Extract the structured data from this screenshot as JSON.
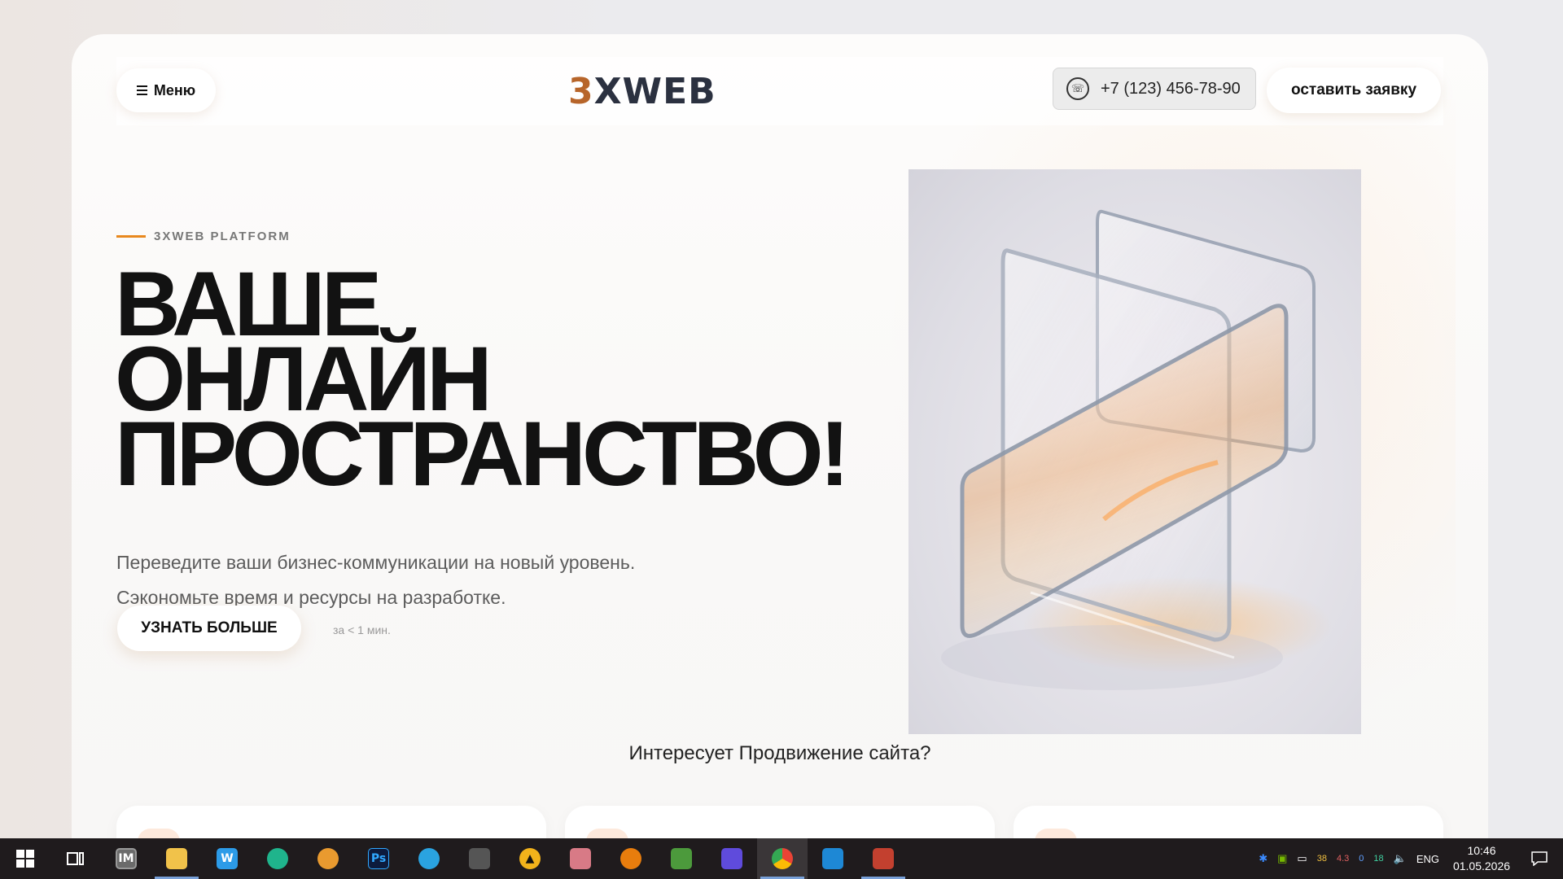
{
  "header": {
    "menu_label": "Меню",
    "logo_prefix": "3",
    "logo_rest": "XWEB",
    "phone": "+7 (123) 456-78-90",
    "cta_label": "оставить заявку"
  },
  "hero": {
    "eyebrow": "3XWEB PLATFORM",
    "title_lines": [
      "ВАШЕ",
      "ОНЛАЙН",
      "ПРОСТРАНСТВО!"
    ],
    "subtitle_lines": [
      "Переведите ваши бизнес-коммуникации на новый уровень.",
      "Сэкономьте время и ресурсы на разработке."
    ],
    "button_label": "УЗНАТЬ БОЛЬШЕ",
    "time_note": "за < 1 мин."
  },
  "section": {
    "question": "Интересует Продвижение сайта?"
  },
  "taskbar": {
    "apps": [
      {
        "name": "start-icon",
        "glyph": "",
        "color": "#ffffff"
      },
      {
        "name": "task-view-icon",
        "glyph": "",
        "color": "#ffffff"
      },
      {
        "name": "app-im-icon",
        "glyph": "IM",
        "color": "#6b6b6b"
      },
      {
        "name": "file-explorer-icon",
        "glyph": "",
        "color": "#f1c24a"
      },
      {
        "name": "app-w-icon",
        "glyph": "W",
        "color": "#2c9be8"
      },
      {
        "name": "app-turtle-icon",
        "glyph": "",
        "color": "#1fb48c"
      },
      {
        "name": "app-eye-icon",
        "glyph": "",
        "color": "#e99a2f"
      },
      {
        "name": "photoshop-icon",
        "glyph": "Ps",
        "color": "#0d1b3d"
      },
      {
        "name": "telegram-icon",
        "glyph": "",
        "color": "#2aa3e0"
      },
      {
        "name": "app-gamepad-icon",
        "glyph": "",
        "color": "#2b2b2b"
      },
      {
        "name": "app-triangle-icon",
        "glyph": "▲",
        "color": "#f2b31b"
      },
      {
        "name": "app-character-icon",
        "glyph": "",
        "color": "#d87a86"
      },
      {
        "name": "blender-icon",
        "glyph": "",
        "color": "#e87d0d"
      },
      {
        "name": "app-image-icon",
        "glyph": "",
        "color": "#4c9a3c"
      },
      {
        "name": "app-chat-icon",
        "glyph": "",
        "color": "#5f4bdc"
      },
      {
        "name": "chrome-icon",
        "glyph": "",
        "color": "#ea4335"
      },
      {
        "name": "vscode-icon",
        "glyph": "",
        "color": "#1e88d5"
      },
      {
        "name": "app-books-icon",
        "glyph": "",
        "color": "#c3402f"
      }
    ],
    "tray": {
      "n1": "38",
      "n2": "4.3",
      "n3": "0",
      "n4": "18",
      "lang": "ENG",
      "time": "10:46",
      "date": "01.05.2026"
    }
  }
}
